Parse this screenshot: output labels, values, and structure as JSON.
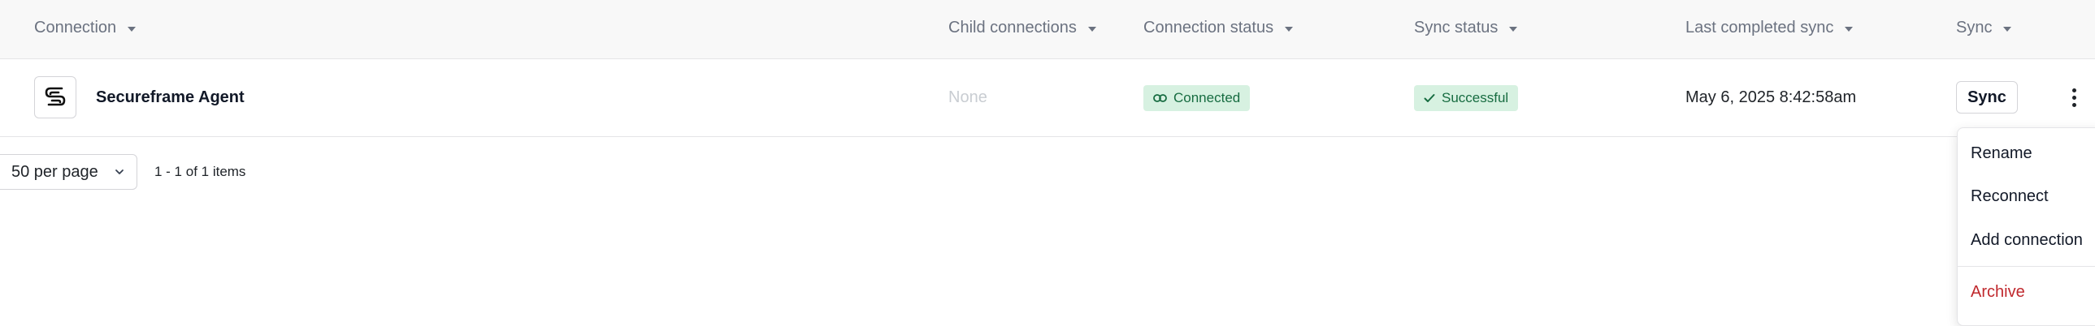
{
  "table": {
    "columns": {
      "connection": "Connection",
      "child_connections": "Child connections",
      "connection_status": "Connection status",
      "sync_status": "Sync status",
      "last_completed_sync": "Last completed sync",
      "sync": "Sync"
    },
    "rows": [
      {
        "icon": "secureframe-logo",
        "name": "Secureframe Agent",
        "child_connections": "None",
        "connection_status": "Connected",
        "connection_status_icon": "link-icon",
        "sync_status": "Successful",
        "sync_status_icon": "check-icon",
        "last_completed_sync": "May 6, 2025 8:42:58am",
        "sync_button_label": "Sync"
      }
    ]
  },
  "pagination": {
    "per_page": "50 per page",
    "info": "1 - 1 of 1 items"
  },
  "row_menu": {
    "items": [
      "Rename",
      "Reconnect",
      "Add connection"
    ],
    "danger_item": "Archive"
  },
  "colors": {
    "status_badge_bg": "#d7f1e1",
    "status_badge_text": "#176c41",
    "danger": "#c0282d",
    "header_bg": "#f8f8f8"
  }
}
